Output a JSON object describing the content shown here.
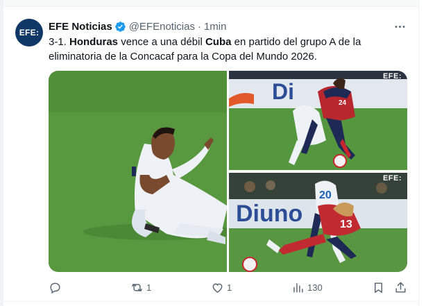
{
  "tweet": {
    "avatar_text": "EFE:",
    "author_name": "EFE Noticias",
    "handle": "@EFEnoticias",
    "separator": "·",
    "time": "1min",
    "text_parts": {
      "t1": "3-1. ",
      "b1": "Honduras",
      "t2": " vence a una débil ",
      "b2": "Cuba",
      "t3": " en partido del grupo A de la eliminatoria de la Concacaf para la Copa del Mundo 2026."
    },
    "watermark": "EFE:",
    "board_text_1": "Di",
    "board_text_2": "Diuno",
    "jersey_1": "24",
    "jersey_2": "20",
    "jersey_3": "13"
  },
  "actions": {
    "reply_count": "",
    "retweet_count": "1",
    "like_count": "1",
    "views_count": "130"
  },
  "colors": {
    "accent_blue": "#1d9bf0",
    "secondary_text": "#536471",
    "avatar_bg": "#0f3866"
  }
}
